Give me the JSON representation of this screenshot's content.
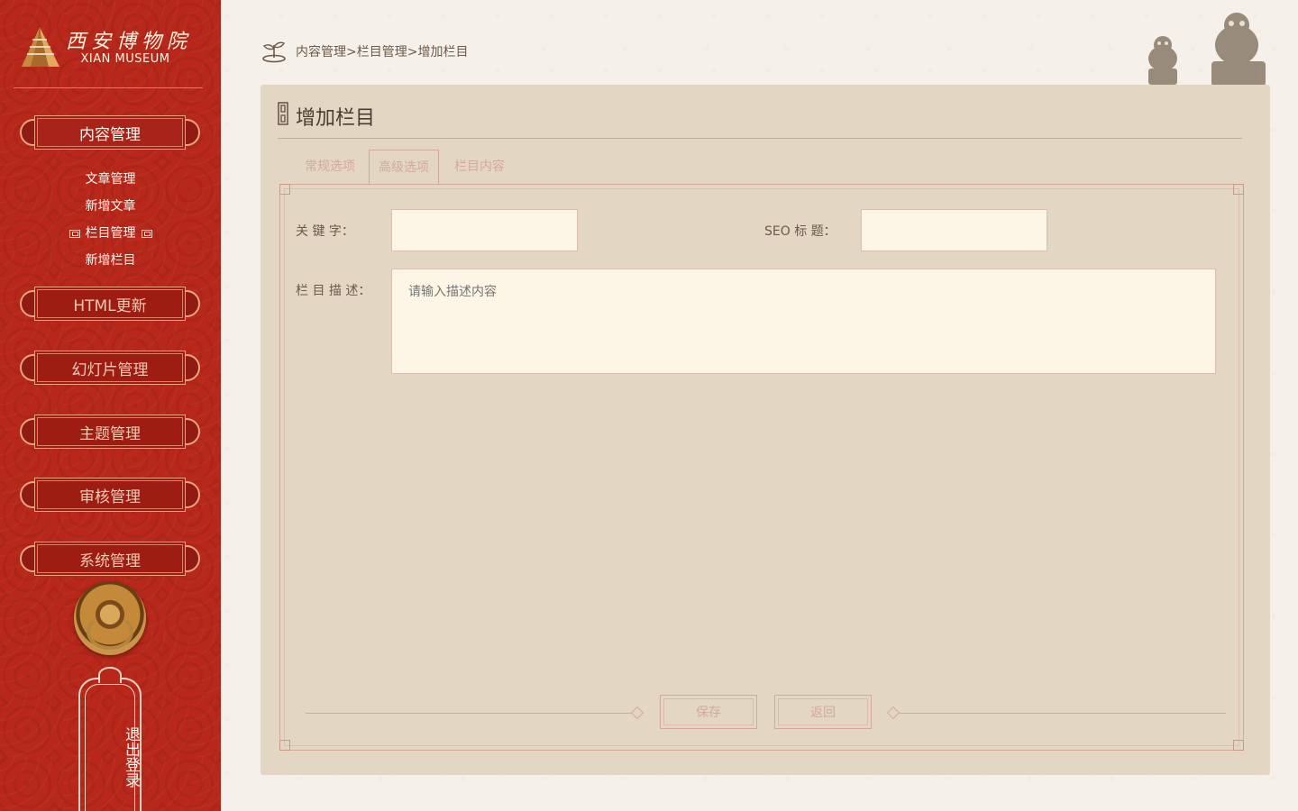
{
  "brand": {
    "name_cn": "西安博物院",
    "name_en": "XIAN MUSEUM"
  },
  "sidebar": {
    "menu": [
      {
        "label": "内容管理",
        "active": true
      },
      {
        "label": "HTML更新",
        "active": false
      },
      {
        "label": "幻灯片管理",
        "active": false
      },
      {
        "label": "主题管理",
        "active": false
      },
      {
        "label": "审核管理",
        "active": false
      },
      {
        "label": "系统管理",
        "active": false
      }
    ],
    "submenu": [
      {
        "label": "文章管理",
        "current": false
      },
      {
        "label": "新增文章",
        "current": false
      },
      {
        "label": "栏目管理",
        "current": true
      },
      {
        "label": "新增栏目",
        "current": false
      }
    ],
    "logout": "退出登录"
  },
  "breadcrumb": {
    "text": "内容管理>栏目管理>增加栏目",
    "items": [
      "内容管理",
      "栏目管理",
      "增加栏目"
    ]
  },
  "panel": {
    "title": "增加栏目",
    "tabs": [
      {
        "label": "常规选项",
        "active": false
      },
      {
        "label": "高级选项",
        "active": true
      },
      {
        "label": "栏目内容",
        "active": false
      }
    ]
  },
  "form": {
    "keywords_label": "关  键  字：",
    "keywords_value": "",
    "seo_title_label": "SEO 标  题：",
    "seo_title_value": "",
    "description_label": "栏 目 描 述：",
    "description_placeholder": "请输入描述内容",
    "save_label": "保存",
    "back_label": "返回"
  },
  "colors": {
    "sidebar_red": "#b7271a",
    "panel_bg": "#e3d6c3",
    "input_bg": "#fdf5e6",
    "accent_border": "#d6aa98"
  }
}
